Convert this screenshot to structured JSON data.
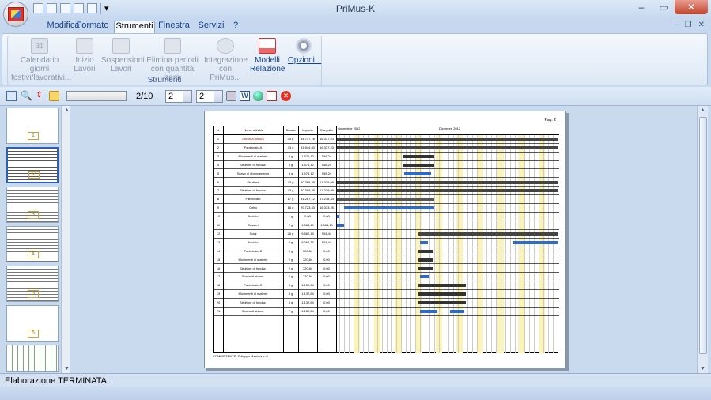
{
  "window": {
    "title": "PriMus-K",
    "controls": [
      "minimize",
      "maximize",
      "close"
    ]
  },
  "tabs": [
    "Modifica",
    "Formato",
    "Strumenti",
    "Finestra",
    "Servizi",
    "?"
  ],
  "active_tab": "Strumenti",
  "ribbon": {
    "group_label": "Strumenti",
    "buttons": [
      {
        "label": "Calendario giorni festivi/lavorativi...",
        "enabled": false,
        "icon": "calendar-icon"
      },
      {
        "label": "Inizio Lavori",
        "enabled": false,
        "icon": "start-work-icon"
      },
      {
        "label": "Sospensioni Lavori",
        "enabled": false,
        "icon": "suspension-icon"
      },
      {
        "label": "Elimina periodi con quantità zero",
        "enabled": false,
        "icon": "delete-periods-icon"
      },
      {
        "label": "Integrazione con PriMus...",
        "enabled": false,
        "icon": "integration-icon"
      },
      {
        "label": "Modelli Relazione",
        "enabled": true,
        "icon": "report-models-icon"
      },
      {
        "label": "Opzioni...",
        "enabled": true,
        "icon": "gears-icon"
      }
    ]
  },
  "toolbar": {
    "page_indicator": "2/10",
    "spin1": "2",
    "spin2": "2"
  },
  "preview": {
    "page_label": "Pag. 2",
    "columns": [
      "N.",
      "Nome attività",
      "Durata",
      "Importo",
      "Eseguito"
    ],
    "rows": [
      {
        "n": "1",
        "name": "Lavori a misura",
        "dur": "43 g",
        "imp": "44.717,78",
        "ese": "16.337,23",
        "red": true
      },
      {
        "n": "2",
        "name": "Fabbricato A",
        "dur": "43 g",
        "imp": "41.944,50",
        "ese": "16.337,23"
      },
      {
        "n": "3",
        "name": "Movimenti di materie",
        "dur": "4 g",
        "imp": "1.576,12",
        "ese": "558,24"
      },
      {
        "n": "4",
        "name": "Strutture di fondaz.",
        "dur": "4 g",
        "imp": "1.576,12",
        "ese": "558,24"
      },
      {
        "n": "5",
        "name": "Scavo di sbancamento",
        "dur": "4 g",
        "imp": "1.576,12",
        "ese": "558,24"
      },
      {
        "n": "6",
        "name": "Strutture",
        "dur": "43 g",
        "imp": "40.368,38",
        "ese": "17.339,99"
      },
      {
        "n": "7",
        "name": "Strutture di fondaz.",
        "dur": "43 g",
        "imp": "40.368,38",
        "ese": "17.339,99"
      },
      {
        "n": "8",
        "name": "Fabbricato",
        "dur": "17 g",
        "imp": "31.287,12",
        "ese": "17.218,44"
      },
      {
        "n": "9",
        "name": "Getto",
        "dur": "16 g",
        "imp": "29.723,33",
        "ese": "16.333,25"
      },
      {
        "n": "10",
        "name": "Acciaio",
        "dur": "1 g",
        "imp": "0,00",
        "ese": "0,00"
      },
      {
        "n": "11",
        "name": "Casseri",
        "dur": "2 g",
        "imp": "1.564,10",
        "ese": "1.564,10"
      },
      {
        "n": "12",
        "name": "Solai",
        "dur": "26 g",
        "imp": "9.662,15",
        "ese": "554,44"
      },
      {
        "n": "13",
        "name": "Acciaio",
        "dur": "2 g",
        "imp": "9.662,15",
        "ese": "554,44"
      },
      {
        "n": "14",
        "name": "Fabbricato B",
        "dur": "4 g",
        "imp": "720,84",
        "ese": "0,00"
      },
      {
        "n": "15",
        "name": "Movimenti di materie",
        "dur": "2 g",
        "imp": "720,84",
        "ese": "0,00"
      },
      {
        "n": "16",
        "name": "Strutture di fondaz.",
        "dur": "2 g",
        "imp": "720,84",
        "ese": "0,00"
      },
      {
        "n": "17",
        "name": "Scavo di sbanc.",
        "dur": "2 g",
        "imp": "720,84",
        "ese": "0,00"
      },
      {
        "n": "18",
        "name": "Fabbricato C",
        "dur": "8 g",
        "imp": "1.132,64",
        "ese": "0,00"
      },
      {
        "n": "19",
        "name": "Movimenti di materie",
        "dur": "8 g",
        "imp": "1.132,64",
        "ese": "0,00"
      },
      {
        "n": "20",
        "name": "Strutture di fondaz.",
        "dur": "8 g",
        "imp": "1.132,64",
        "ese": "0,00"
      },
      {
        "n": "21",
        "name": "Scavo di sbanc.",
        "dur": "7 g",
        "imp": "1.132,64",
        "ese": "0,00"
      }
    ],
    "footer": "COMMITTENTE: Sviluppo Mariosa s.r.l.",
    "timeline_labels": [
      "Novembre 2012",
      "Dicembre 2012"
    ]
  },
  "thumbnails": [
    "1",
    "2",
    "3",
    "4",
    "5",
    "6"
  ],
  "status": "Elaborazione TERMINATA."
}
